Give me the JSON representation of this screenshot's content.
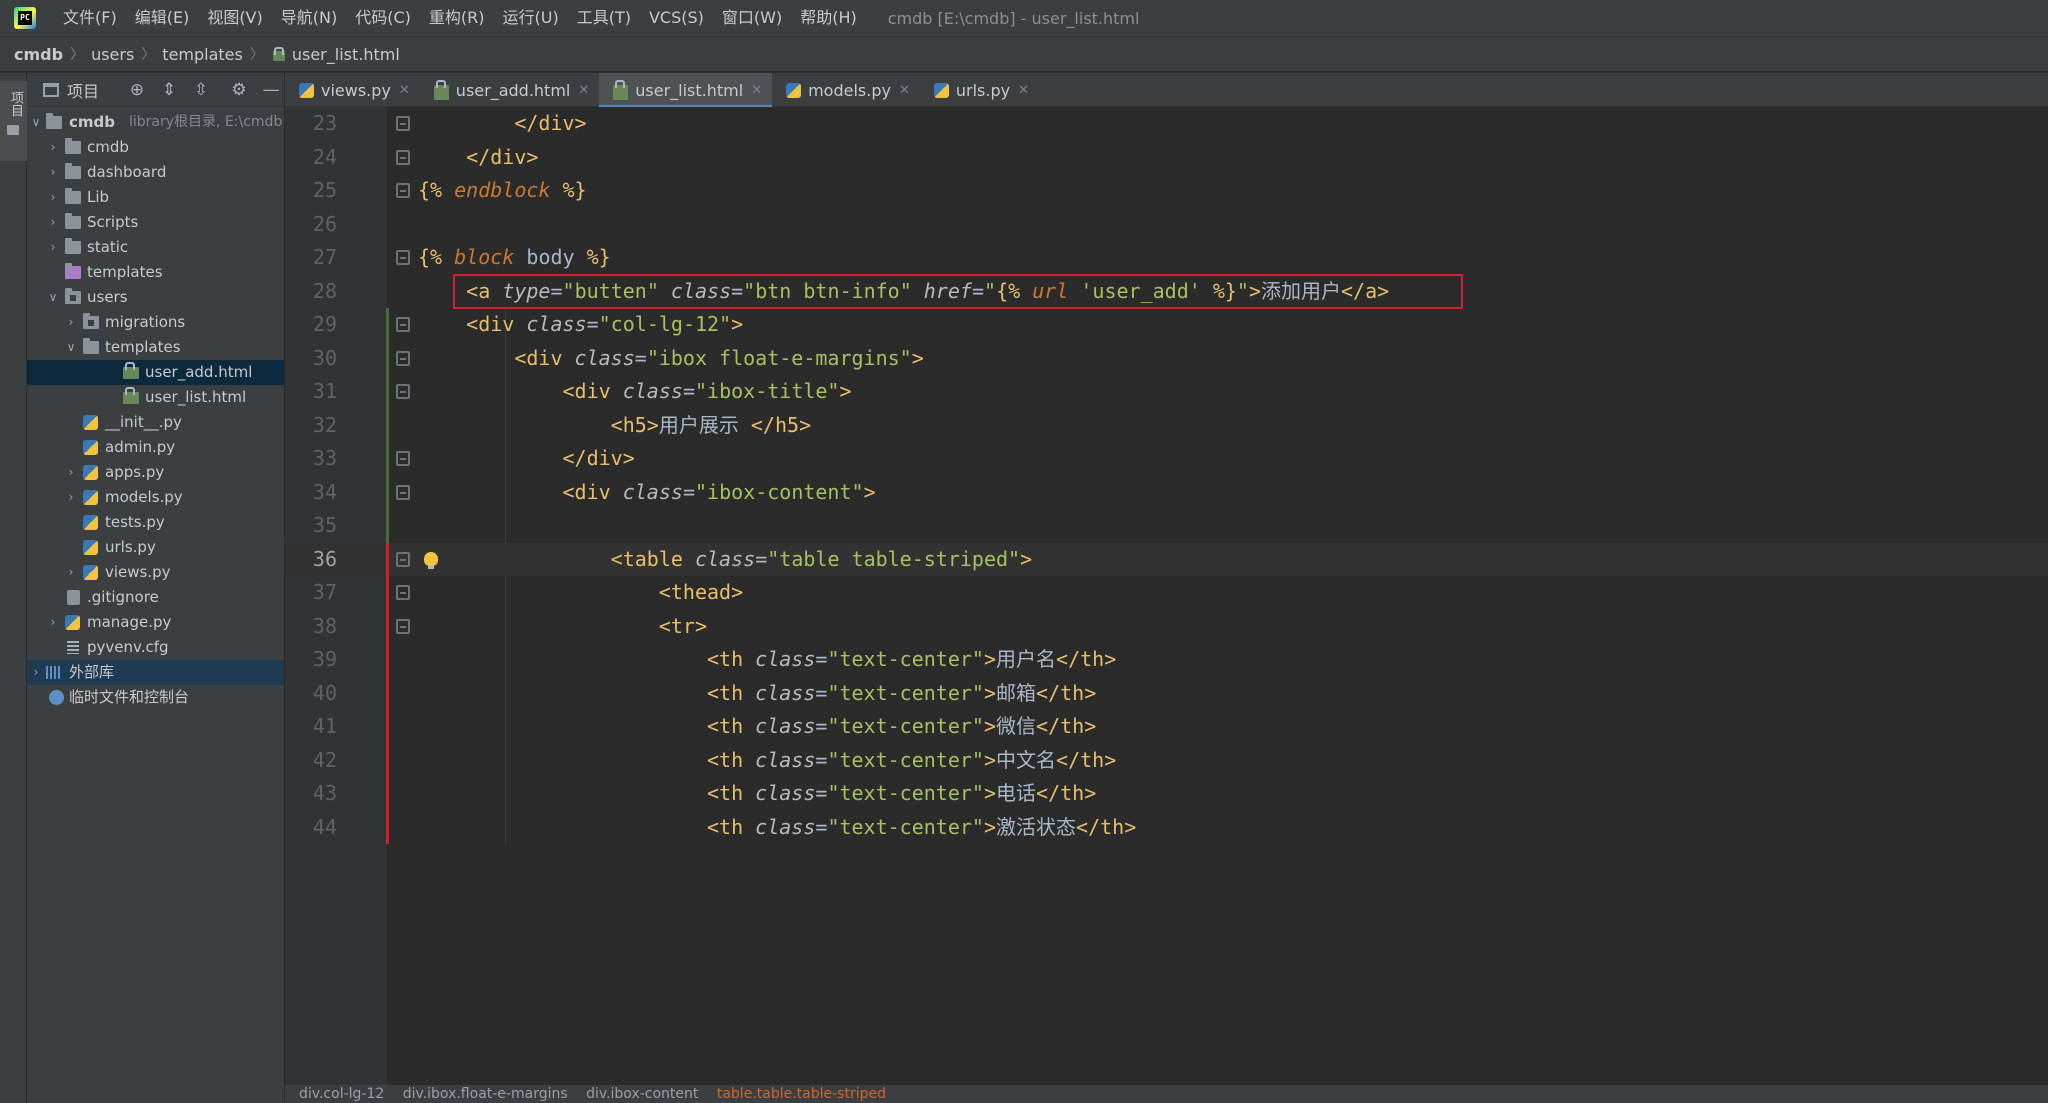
{
  "app": {
    "logo_text": "PC",
    "window_title": "cmdb [E:\\cmdb] - user_list.html"
  },
  "menu": [
    "文件(F)",
    "编辑(E)",
    "视图(V)",
    "导航(N)",
    "代码(C)",
    "重构(R)",
    "运行(U)",
    "工具(T)",
    "VCS(S)",
    "窗口(W)",
    "帮助(H)"
  ],
  "breadcrumb": [
    "cmdb",
    "users",
    "templates",
    "user_list.html"
  ],
  "tool_strip": {
    "project_label": "项目"
  },
  "project_panel": {
    "title": "项目",
    "tree": [
      {
        "label": "cmdb",
        "extra": "library根目录,  E:\\cmdb"
      },
      {
        "label": "cmdb"
      },
      {
        "label": "dashboard"
      },
      {
        "label": "Lib"
      },
      {
        "label": "Scripts"
      },
      {
        "label": "static"
      },
      {
        "label": "templates"
      },
      {
        "label": "users"
      },
      {
        "label": "migrations"
      },
      {
        "label": "templates"
      },
      {
        "label": "user_add.html"
      },
      {
        "label": "user_list.html"
      },
      {
        "label": "__init__.py"
      },
      {
        "label": "admin.py"
      },
      {
        "label": "apps.py"
      },
      {
        "label": "models.py"
      },
      {
        "label": "tests.py"
      },
      {
        "label": "urls.py"
      },
      {
        "label": "views.py"
      },
      {
        "label": ".gitignore"
      },
      {
        "label": "manage.py"
      },
      {
        "label": "pyvenv.cfg"
      },
      {
        "label": "外部库"
      },
      {
        "label": "临时文件和控制台"
      }
    ]
  },
  "tabs": [
    {
      "label": "views.py",
      "active": false
    },
    {
      "label": "user_add.html",
      "active": false
    },
    {
      "label": "user_list.html",
      "active": true
    },
    {
      "label": "models.py",
      "active": false
    },
    {
      "label": "urls.py",
      "active": false
    }
  ],
  "editor": {
    "current_line": 36,
    "lines": [
      {
        "n": "23",
        "text": "        </div>"
      },
      {
        "n": "24",
        "text": "    </div>"
      },
      {
        "n": "25",
        "text": "{% endblock %}"
      },
      {
        "n": "26",
        "text": ""
      },
      {
        "n": "27",
        "text": "{% block body %}"
      },
      {
        "n": "28",
        "text": "    <a type=\"butten\" class=\"btn btn-info\" href=\"{% url 'user_add' %}\">添加用户</a>"
      },
      {
        "n": "29",
        "text": "    <div class=\"col-lg-12\">"
      },
      {
        "n": "30",
        "text": "        <div class=\"ibox float-e-margins\">"
      },
      {
        "n": "31",
        "text": "            <div class=\"ibox-title\">"
      },
      {
        "n": "32",
        "text": "                <h5>用户展示 </h5>"
      },
      {
        "n": "33",
        "text": "            </div>"
      },
      {
        "n": "34",
        "text": "            <div class=\"ibox-content\">"
      },
      {
        "n": "35",
        "text": ""
      },
      {
        "n": "36",
        "text": "                <table class=\"table table-striped\">"
      },
      {
        "n": "37",
        "text": "                    <thead>"
      },
      {
        "n": "38",
        "text": "                    <tr>"
      },
      {
        "n": "39",
        "text": "                        <th class=\"text-center\">用户名</th>"
      },
      {
        "n": "40",
        "text": "                        <th class=\"text-center\">邮箱</th>"
      },
      {
        "n": "41",
        "text": "                        <th class=\"text-center\">微信</th>"
      },
      {
        "n": "42",
        "text": "                        <th class=\"text-center\">中文名</th>"
      },
      {
        "n": "43",
        "text": "                        <th class=\"text-center\">电话</th>"
      },
      {
        "n": "44",
        "text": "                        <th class=\"text-center\">激活状态</th>"
      }
    ]
  },
  "editor_breadcrumb": [
    "div.col-lg-12",
    "div.ibox.float-e-margins",
    "div.ibox-content",
    "table.table.table-striped"
  ],
  "colors": {
    "tag": "#e8bf6a",
    "attribute": "#bababa",
    "string": "#a5c261",
    "template_keyword": "#cc7832",
    "highlight_border": "#d11f2c",
    "active_tab_underline": "#4a88c7"
  }
}
